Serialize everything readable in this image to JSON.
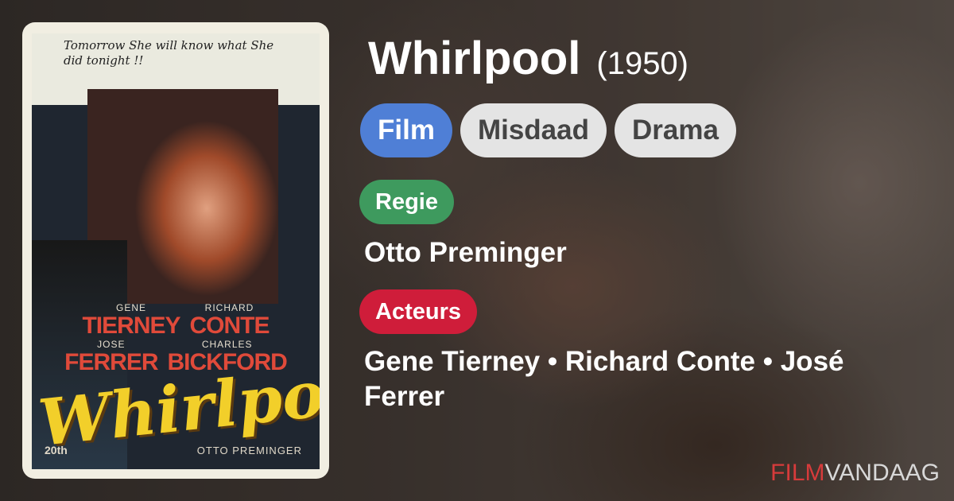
{
  "movie": {
    "title": "Whirlpool",
    "year": "(1950)"
  },
  "tags": [
    "Film",
    "Misdaad",
    "Drama"
  ],
  "credits": {
    "director_label": "Regie",
    "director": "Otto Preminger",
    "actors_label": "Acteurs",
    "actors": "Gene Tierney • Richard Conte • José Ferrer"
  },
  "poster": {
    "tagline": "Tomorrow She will know what She did tonight !!",
    "names_top": [
      {
        "first": "GENE",
        "last": "TIERNEY"
      },
      {
        "first": "RICHARD",
        "last": "CONTE"
      }
    ],
    "names_bottom": [
      {
        "first": "JOSE",
        "last": "FERRER"
      },
      {
        "first": "CHARLES",
        "last": "BICKFORD"
      }
    ],
    "art_title": "Whirlpool",
    "studio": "20th",
    "director_credit": "OTTO PREMINGER"
  },
  "brand": {
    "part1": "FILM",
    "part2": "VANDAAG"
  },
  "colors": {
    "film_chip": "#4f7fd6",
    "genre_chip": "#e4e4e4",
    "regie_label": "#3e9a5e",
    "acteurs_label": "#cf1d3a",
    "brand_red": "#d63b3b"
  }
}
